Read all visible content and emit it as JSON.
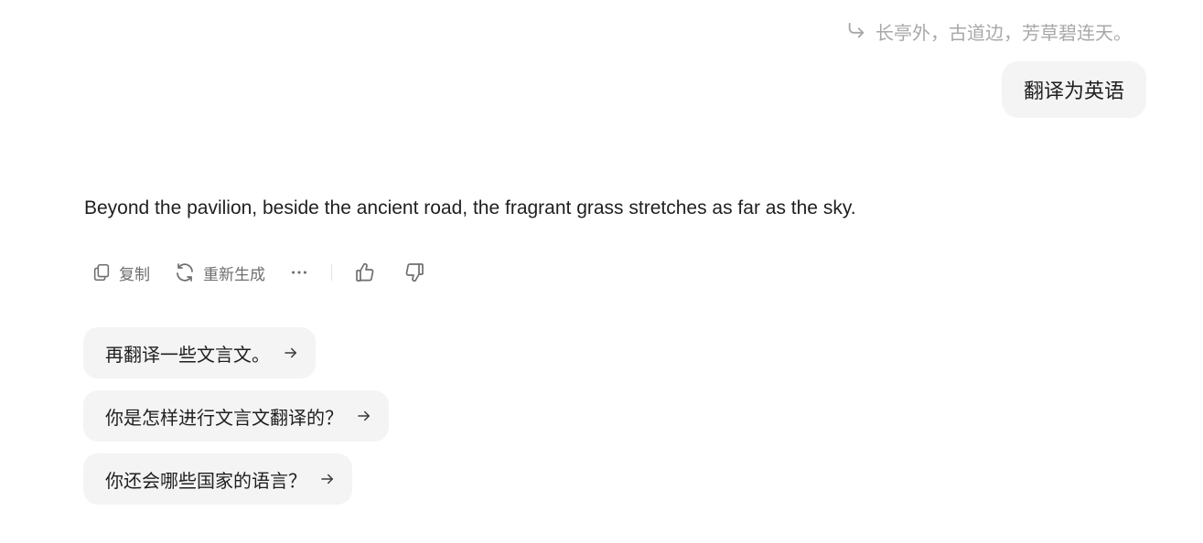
{
  "quote": {
    "icon": "reply-arrow-icon",
    "text": "长亭外，古道边，芳草碧连天。"
  },
  "user_message": {
    "text": "翻译为英语"
  },
  "assistant_message": {
    "text": "Beyond the pavilion, beside the ancient road, the fragrant grass stretches as far as the sky."
  },
  "toolbar": {
    "copy_label": "复制",
    "copy_icon": "copy-icon",
    "regenerate_label": "重新生成",
    "regenerate_icon": "refresh-icon",
    "more_icon": "more-dots-icon",
    "like_icon": "thumbs-up-icon",
    "dislike_icon": "thumbs-down-icon"
  },
  "suggestions": [
    {
      "text": "再翻译一些文言文。",
      "icon": "arrow-right-icon"
    },
    {
      "text": "你是怎样进行文言文翻译的？",
      "icon": "arrow-right-icon"
    },
    {
      "text": "你还会哪些国家的语言？",
      "icon": "arrow-right-icon"
    }
  ],
  "colors": {
    "bubble_bg": "#f4f4f5",
    "muted_text": "#a8a8a8",
    "toolbar_text": "#6e6e6e",
    "body_text": "#1f1f1f"
  }
}
